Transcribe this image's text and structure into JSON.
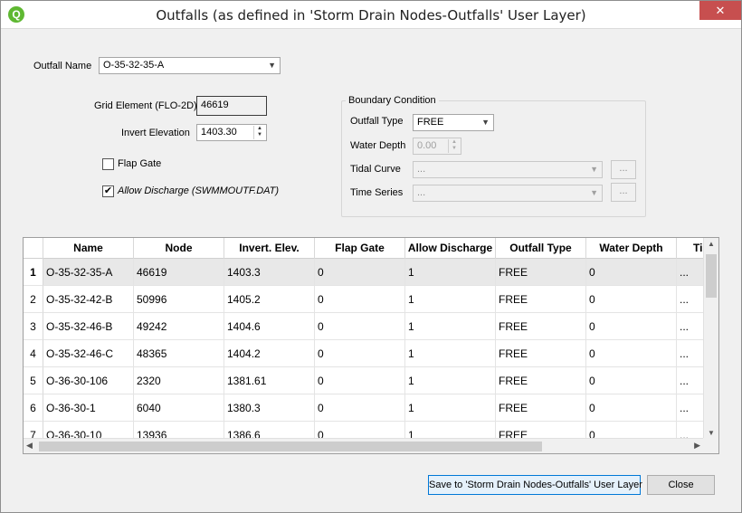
{
  "window": {
    "title": "Outfalls (as defined in 'Storm Drain Nodes-Outfalls' User Layer)",
    "app_icon": "Q",
    "close_glyph": "✕"
  },
  "form": {
    "outfall_name_label": "Outfall Name",
    "outfall_name_value": "O-35-32-35-A",
    "grid_element_label": "Grid Element (FLO-2D)",
    "grid_element_value": "46619",
    "invert_elevation_label": "Invert Elevation",
    "invert_elevation_value": "1403.30",
    "flap_gate_label": "Flap Gate",
    "flap_gate_checked": false,
    "allow_discharge_label": "Allow Discharge (SWMMOUTF.DAT)",
    "allow_discharge_checked": true
  },
  "boundary": {
    "title": "Boundary Condition",
    "outfall_type_label": "Outfall Type",
    "outfall_type_value": "FREE",
    "water_depth_label": "Water Depth",
    "water_depth_value": "0.00",
    "tidal_curve_label": "Tidal Curve",
    "tidal_curve_value": "...",
    "time_series_label": "Time Series",
    "time_series_value": "...",
    "dots_label": "..."
  },
  "table": {
    "columns": [
      "Name",
      "Node",
      "Invert. Elev.",
      "Flap Gate",
      "Allow Discharge",
      "Outfall Type",
      "Water Depth",
      "Ti"
    ],
    "rows": [
      {
        "num": "1",
        "cells": [
          "O-35-32-35-A",
          "46619",
          "1403.3",
          "0",
          "1",
          "FREE",
          "0",
          "..."
        ]
      },
      {
        "num": "2",
        "cells": [
          "O-35-32-42-B",
          "50996",
          "1405.2",
          "0",
          "1",
          "FREE",
          "0",
          "..."
        ]
      },
      {
        "num": "3",
        "cells": [
          "O-35-32-46-B",
          "49242",
          "1404.6",
          "0",
          "1",
          "FREE",
          "0",
          "..."
        ]
      },
      {
        "num": "4",
        "cells": [
          "O-35-32-46-C",
          "48365",
          "1404.2",
          "0",
          "1",
          "FREE",
          "0",
          "..."
        ]
      },
      {
        "num": "5",
        "cells": [
          "O-36-30-106",
          "2320",
          "1381.61",
          "0",
          "1",
          "FREE",
          "0",
          "..."
        ]
      },
      {
        "num": "6",
        "cells": [
          "O-36-30-1",
          "6040",
          "1380.3",
          "0",
          "1",
          "FREE",
          "0",
          "..."
        ]
      },
      {
        "num": "7",
        "cells": [
          "O-36-30-10",
          "13936",
          "1386.6",
          "0",
          "1",
          "FREE",
          "0",
          "..."
        ]
      }
    ]
  },
  "footer": {
    "save_label": "Save to 'Storm Drain Nodes-Outfalls' User Layer",
    "close_label": "Close"
  }
}
